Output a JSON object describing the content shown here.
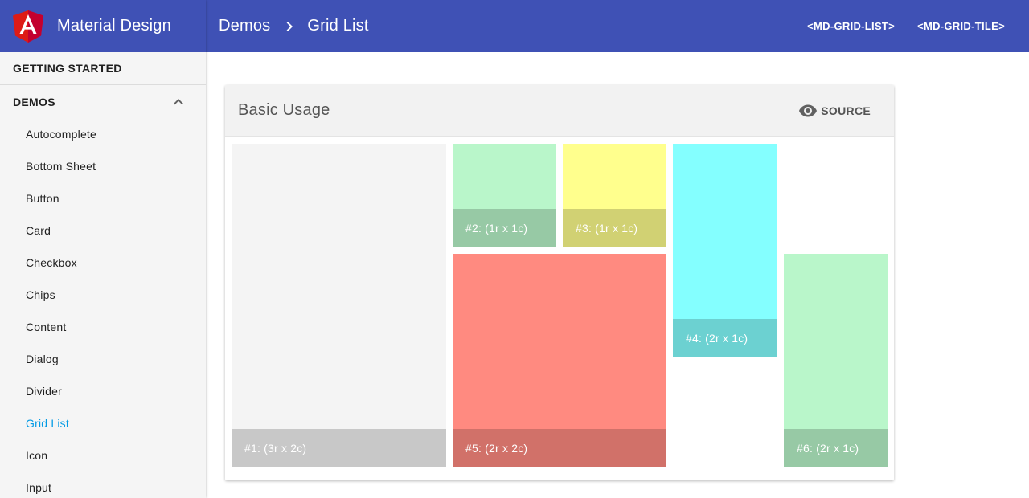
{
  "app": {
    "title": "Material Design",
    "logo_icon": "angular-shield-icon",
    "brand_color": "#3f51b5"
  },
  "header": {
    "breadcrumb": [
      "Demos",
      "Grid List"
    ],
    "separator_icon": "chevron-right-icon",
    "links": [
      "<MD-GRID-LIST>",
      "<MD-GRID-TILE>"
    ]
  },
  "sidebar": {
    "getting_started": "GETTING STARTED",
    "demos": {
      "label": "DEMOS",
      "expanded_icon": "chevron-up-icon"
    },
    "items": [
      {
        "label": "Autocomplete"
      },
      {
        "label": "Bottom Sheet"
      },
      {
        "label": "Button"
      },
      {
        "label": "Card"
      },
      {
        "label": "Checkbox"
      },
      {
        "label": "Chips"
      },
      {
        "label": "Content"
      },
      {
        "label": "Dialog"
      },
      {
        "label": "Divider"
      },
      {
        "label": "Grid List",
        "active": true
      },
      {
        "label": "Icon"
      },
      {
        "label": "Input"
      }
    ],
    "active_color": "#039be5"
  },
  "demo": {
    "title": "Basic Usage",
    "source_label": "SOURCE",
    "source_icon": "eye-icon",
    "tiles": [
      {
        "label": "#1: (3r x 2c)",
        "color": "#f4f4f4"
      },
      {
        "label": "#2: (1r x 1c)",
        "color": "#b9f6ca"
      },
      {
        "label": "#3: (1r x 1c)",
        "color": "#ffff8d"
      },
      {
        "label": "#4: (2r x 1c)",
        "color": "#84ffff"
      },
      {
        "label": "#5: (2r x 2c)",
        "color": "#ff8a80"
      },
      {
        "label": "#6: (2r x 1c)",
        "color": "#b9f6ca"
      }
    ]
  }
}
